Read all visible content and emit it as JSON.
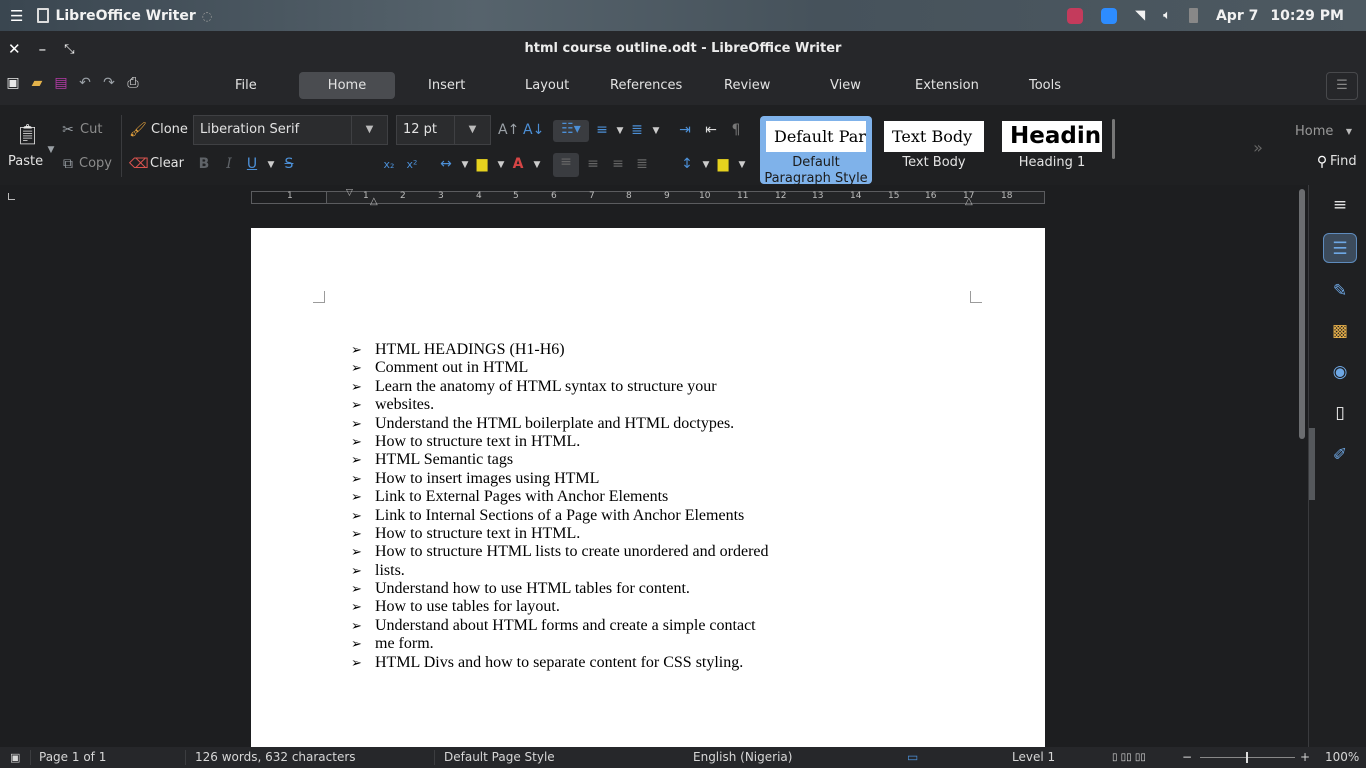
{
  "system": {
    "app_name": "LibreOffice Writer",
    "date": "Apr 7",
    "time": "10:29 PM"
  },
  "window": {
    "title": "html course outline.odt - LibreOffice Writer"
  },
  "menu_tabs": [
    {
      "label": "File"
    },
    {
      "label": "Home"
    },
    {
      "label": "Insert"
    },
    {
      "label": "Layout"
    },
    {
      "label": "References"
    },
    {
      "label": "Review"
    },
    {
      "label": "View"
    },
    {
      "label": "Extension"
    },
    {
      "label": "Tools"
    }
  ],
  "active_tab": "Home",
  "ribbon": {
    "paste_label": "Paste",
    "cut_label": "Cut",
    "copy_label": "Copy",
    "clone_label": "Clone",
    "clear_label": "Clear",
    "font_name": "Liberation Serif",
    "font_size": "12 pt",
    "styles": [
      {
        "preview": "Default Paragraph Style",
        "caption": "Default Paragraph Style"
      },
      {
        "preview": "Text Body",
        "caption": "Text Body"
      },
      {
        "preview": "Heading 1",
        "caption": "Heading 1"
      }
    ],
    "context_select": "Home",
    "find_label": "Find"
  },
  "ruler_numbers": [
    "1",
    "1",
    "2",
    "3",
    "4",
    "5",
    "6",
    "7",
    "8",
    "9",
    "10",
    "11",
    "12",
    "13",
    "14",
    "15",
    "16",
    "17",
    "18"
  ],
  "document": {
    "bullet_glyph": "➢",
    "items": [
      "HTML HEADINGS (H1-H6)",
      "Comment out in HTML",
      "Learn the anatomy of HTML syntax to structure your",
      "websites.",
      "Understand the HTML boilerplate and HTML doctypes.",
      "How to structure text in HTML.",
      "HTML Semantic tags",
      "How to insert images using HTML",
      "Link to External Pages with Anchor Elements",
      "Link to Internal Sections of a Page with Anchor Elements",
      "How to structure text in HTML.",
      "How to structure HTML lists to create unordered and ordered",
      "lists.",
      "Understand how to use HTML tables for content.",
      "How to use tables for layout.",
      "Understand about HTML forms and create a simple contact",
      "me form.",
      "HTML Divs and how to separate content for CSS styling."
    ]
  },
  "status": {
    "page": "Page 1 of 1",
    "words": "126 words, 632 characters",
    "page_style": "Default Page Style",
    "language": "English (Nigeria)",
    "level": "Level 1",
    "zoom": "100%"
  },
  "colors": {
    "accent": "#7fb2ea",
    "page": "#ffffff",
    "background": "#1d1e20"
  }
}
